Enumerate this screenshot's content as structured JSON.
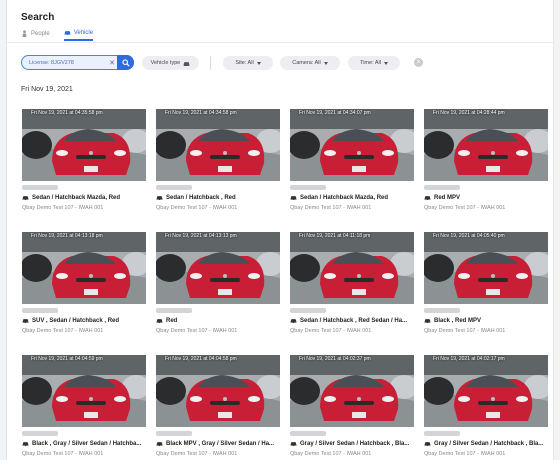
{
  "header": {
    "title": "Search"
  },
  "tabs": [
    {
      "label": "People",
      "icon": "person-icon",
      "active": false
    },
    {
      "label": "Vehicle",
      "icon": "car-icon",
      "active": true
    }
  ],
  "search": {
    "value": "License: 8JGV278",
    "clear_icon": "close-icon",
    "button_icon": "search-icon"
  },
  "filters": {
    "vehicle_type": "Vehicle type",
    "site": "Site: All",
    "camera": "Camera: All",
    "time": "Time: All"
  },
  "date_header": "Fri Nov 19, 2021",
  "results": [
    {
      "timestamp": "Fri Nov 19, 2021 at 04:35:58 pm",
      "description": "Sedan / Hatchback Mazda, Red",
      "camera": "Qbay Demo Test 107 - IWAH 001"
    },
    {
      "timestamp": "Fri Nov 19, 2021 at 04:34:58 pm",
      "description": "Sedan / Hatchback , Red",
      "camera": "Qbay Demo Test 107 - IWAH 001"
    },
    {
      "timestamp": "Fri Nov 19, 2021 at 04:34:07 pm",
      "description": "Sedan / Hatchback Mazda, Red",
      "camera": "Qbay Demo Test 107 - IWAH 001"
    },
    {
      "timestamp": "Fri Nov 19, 2021 at 04:28:44 pm",
      "description": "Red MPV",
      "camera": "Qbay Demo Test 107 - IWAH 001"
    },
    {
      "timestamp": "Fri Nov 19, 2021 at 04:13:18 pm",
      "description": "SUV , Sedan / Hatchback , Red",
      "camera": "Qbay Demo Test 107 - IWAH 001"
    },
    {
      "timestamp": "Fri Nov 19, 2021 at 04:13:13 pm",
      "description": "Red",
      "camera": "Qbay Demo Test 107 - IWAH 001"
    },
    {
      "timestamp": "Fri Nov 19, 2021 at 04:11:18 pm",
      "description": "Sedan / Hatchback , Red Sedan / Ha...",
      "camera": "Qbay Demo Test 107 - IWAH 001"
    },
    {
      "timestamp": "Fri Nov 19, 2021 at 04:05:40 pm",
      "description": "Black , Red MPV",
      "camera": "Qbay Demo Test 107 - IWAH 001"
    },
    {
      "timestamp": "Fri Nov 19, 2021 at 04:04:59 pm",
      "description": "Black , Gray / Silver Sedan / Hatchba...",
      "camera": "Qbay Demo Test 107 - IWAH 001"
    },
    {
      "timestamp": "Fri Nov 19, 2021 at 04:04:58 pm",
      "description": "Black MPV , Gray / Silver Sedan / Ha...",
      "camera": "Qbay Demo Test 107 - IWAH 001"
    },
    {
      "timestamp": "Fri Nov 19, 2021 at 04:02:37 pm",
      "description": "Gray / Silver Sedan / Hatchback , Bla...",
      "camera": "Qbay Demo Test 107 - IWAH 001"
    },
    {
      "timestamp": "Fri Nov 19, 2021 at 04:02:17 pm",
      "description": "Gray / Silver Sedan / Hatchback , Bla...",
      "camera": "Qbay Demo Test 107 - IWAH 001"
    }
  ],
  "colors": {
    "accent": "#2f6be0",
    "car": "#c81f36"
  }
}
